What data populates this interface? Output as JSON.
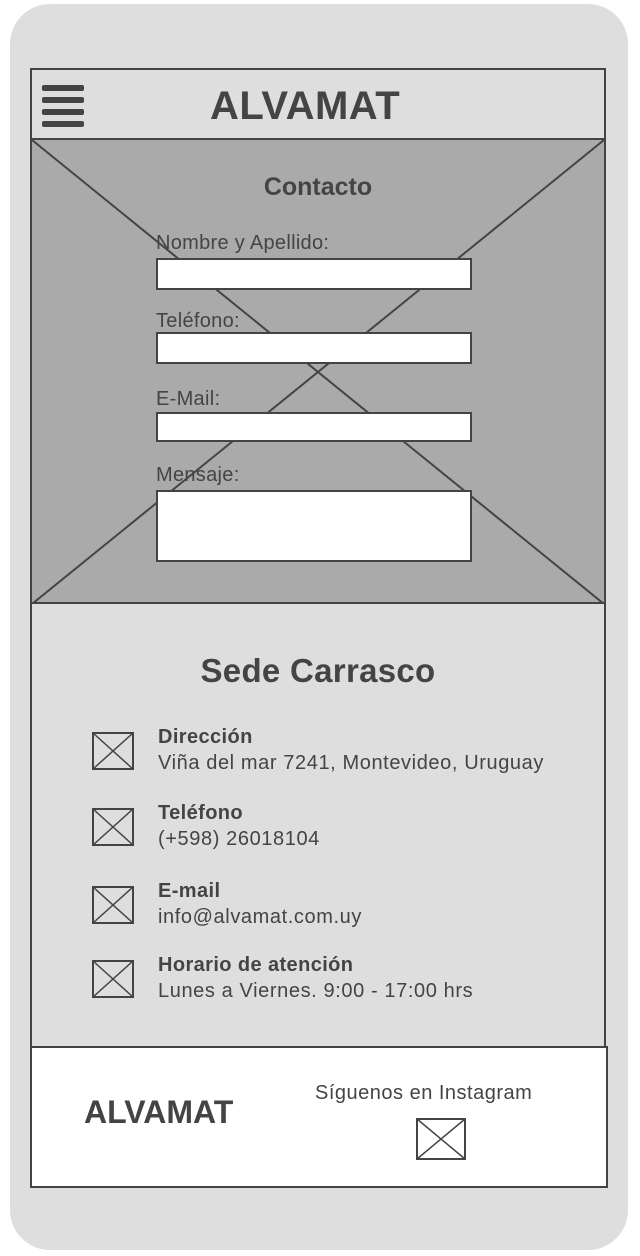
{
  "header": {
    "brand": "ALVAMAT",
    "menu_icon": "hamburger-menu-icon"
  },
  "contact_form": {
    "title": "Contacto",
    "fields": [
      {
        "label": "Nombre y Apellido:",
        "value": "",
        "placeholder": ""
      },
      {
        "label": "Teléfono:",
        "value": "",
        "placeholder": ""
      },
      {
        "label": "E-Mail:",
        "value": "",
        "placeholder": ""
      },
      {
        "label": "Mensaje:",
        "value": "",
        "placeholder": ""
      }
    ]
  },
  "sede": {
    "title": "Sede Carrasco",
    "items": [
      {
        "icon": "image-placeholder-icon",
        "heading": "Dirección",
        "text": "Viña del mar 7241, Montevideo, Uruguay"
      },
      {
        "icon": "image-placeholder-icon",
        "heading": "Teléfono",
        "text": "(+598) 26018104"
      },
      {
        "icon": "image-placeholder-icon",
        "heading": "E-mail",
        "text": "info@alvamat.com.uy"
      },
      {
        "icon": "image-placeholder-icon",
        "heading": "Horario de atención",
        "text": "Lunes a Viernes. 9:00 - 17:00 hrs"
      }
    ]
  },
  "footer": {
    "brand": "ALVAMAT",
    "follow_text": "Síguenos en Instagram",
    "instagram_icon": "instagram-icon"
  },
  "colors": {
    "frame": "#dedede",
    "stroke": "#444444",
    "placeholder_fill": "#aaaaaa",
    "field_fill": "#ffffff"
  }
}
